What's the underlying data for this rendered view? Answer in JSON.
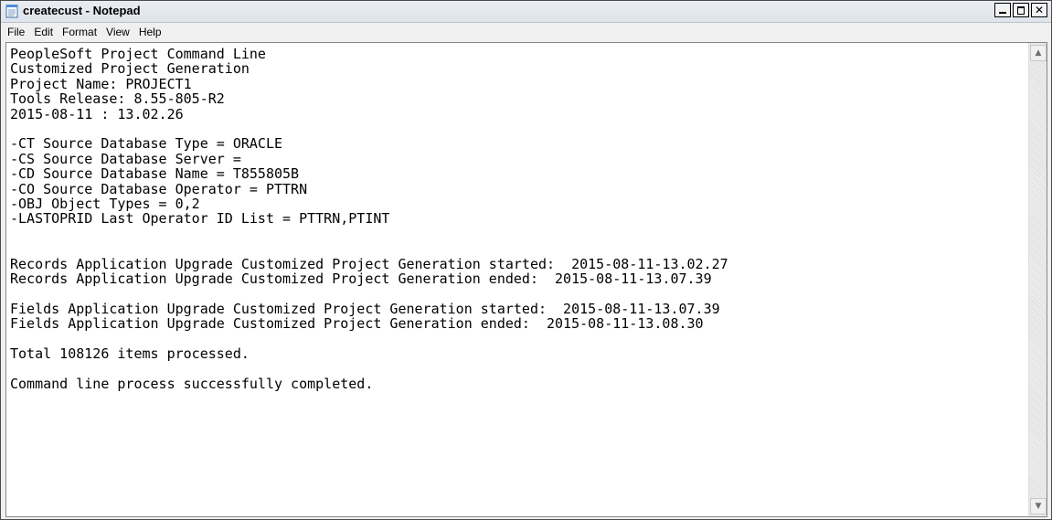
{
  "window": {
    "title": "createcust - Notepad",
    "icon": "notepad-icon",
    "controls": {
      "minimize": "minimize-icon",
      "maximize": "maximize-icon",
      "close": "✕"
    }
  },
  "menu": [
    "File",
    "Edit",
    "Format",
    "View",
    "Help"
  ],
  "document": {
    "lines": [
      "PeopleSoft Project Command Line",
      "Customized Project Generation",
      "Project Name: PROJECT1",
      "Tools Release: 8.55-805-R2",
      "2015-08-11 : 13.02.26",
      "",
      "-CT Source Database Type = ORACLE",
      "-CS Source Database Server =",
      "-CD Source Database Name = T855805B",
      "-CO Source Database Operator = PTTRN",
      "-OBJ Object Types = 0,2",
      "-LASTOPRID Last Operator ID List = PTTRN,PTINT",
      "",
      "",
      "Records Application Upgrade Customized Project Generation started:  2015-08-11-13.02.27",
      "Records Application Upgrade Customized Project Generation ended:  2015-08-11-13.07.39",
      "",
      "Fields Application Upgrade Customized Project Generation started:  2015-08-11-13.07.39",
      "Fields Application Upgrade Customized Project Generation ended:  2015-08-11-13.08.30",
      "",
      "Total 108126 items processed.",
      "",
      "Command line process successfully completed."
    ]
  },
  "scrollbar": {
    "up_arrow": "▲",
    "down_arrow": "▼"
  }
}
